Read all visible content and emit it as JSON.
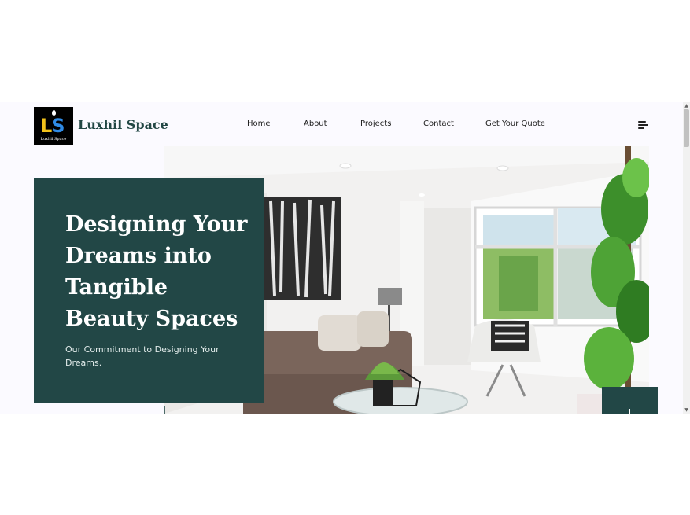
{
  "brand": {
    "name": "Luxhil Space",
    "logo_text": "LS",
    "logo_tagline": "Luxhil Space"
  },
  "nav": {
    "items": [
      {
        "label": "Home"
      },
      {
        "label": "About"
      },
      {
        "label": "Projects"
      },
      {
        "label": "Contact"
      },
      {
        "label": "Get Your Quote"
      }
    ],
    "menu_icon": "hamburger-menu-icon"
  },
  "hero": {
    "title": "Designing Your Dreams into Tangible Beauty Spaces",
    "subtitle": "Our Commitment to Designing Your Dreams.",
    "image": "living-room-photo"
  },
  "colors": {
    "accent": "#224746",
    "brand_text": "#224744",
    "page_bg": "#fbfaff"
  }
}
